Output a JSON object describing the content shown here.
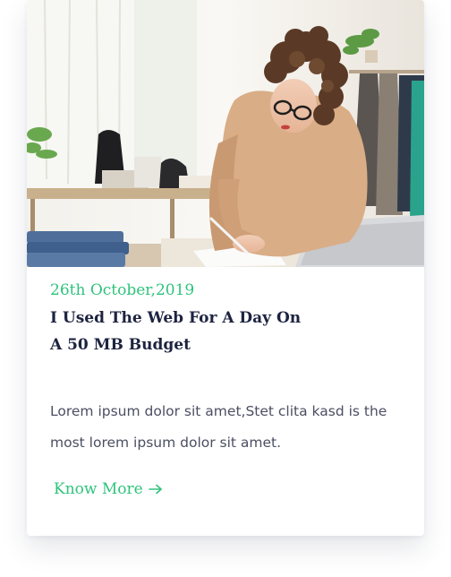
{
  "post": {
    "image_alt": "Woman writing at a desk in a bright boutique studio",
    "date": "26th October,2019",
    "title": "I Used The Web For A Day On A 50 MB Budget",
    "excerpt": "Lorem ipsum dolor sit amet,Stet clita kasd is the most lorem ipsum dolor sit amet.",
    "cta_label": "Know More",
    "cta_icon": "arrow-right-icon"
  },
  "colors": {
    "accent": "#2fc37c",
    "title": "#1d2340",
    "text": "#4b4f62",
    "card_bg": "#ffffff"
  }
}
